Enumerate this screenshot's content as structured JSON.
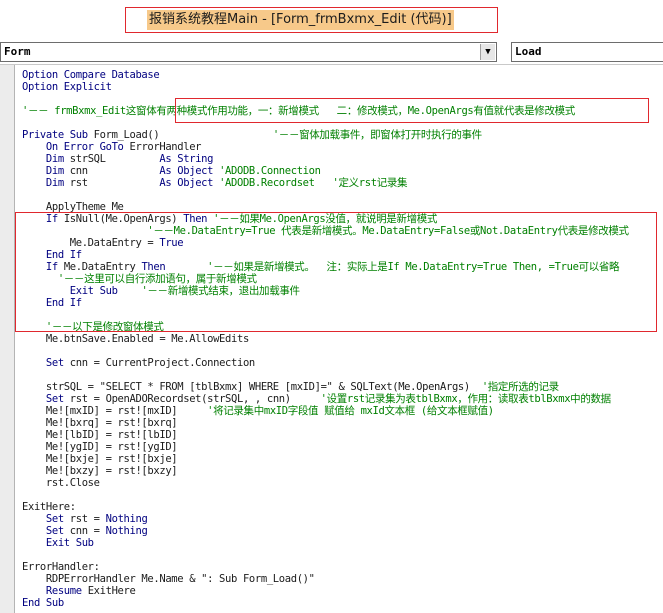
{
  "window": {
    "title": "报销系统教程Main - [Form_frmBxmx_Edit (代码)]"
  },
  "toolbar": {
    "object_combo": "Form",
    "procedure_combo": "Load"
  },
  "code_lines": [
    [
      {
        "t": "Option Compare Database",
        "c": "kw"
      }
    ],
    [
      {
        "t": "Option Explicit",
        "c": "kw"
      }
    ],
    [],
    [
      {
        "t": "'－－ frmBxmx_Edit这窗体有两种模式作用功能，一：新增模式   二：修改模式，Me.OpenArgs有值就代表是修改模式",
        "c": "cm"
      }
    ],
    [],
    [
      {
        "t": "Private Sub ",
        "c": "kw"
      },
      {
        "t": "Form_Load()",
        "c": "cn"
      },
      {
        "t": "                   '－－窗体加载事件，即窗体打开时执行的事件",
        "c": "cm"
      }
    ],
    [
      {
        "t": "    On Error GoTo ",
        "c": "kw"
      },
      {
        "t": "ErrorHandler",
        "c": "cn"
      }
    ],
    [
      {
        "t": "    Dim ",
        "c": "kw"
      },
      {
        "t": "strSQL         ",
        "c": "cn"
      },
      {
        "t": "As String",
        "c": "kw"
      }
    ],
    [
      {
        "t": "    Dim ",
        "c": "kw"
      },
      {
        "t": "cnn            ",
        "c": "cn"
      },
      {
        "t": "As Object ",
        "c": "kw"
      },
      {
        "t": "'ADODB.Connection",
        "c": "cm"
      }
    ],
    [
      {
        "t": "    Dim ",
        "c": "kw"
      },
      {
        "t": "rst            ",
        "c": "cn"
      },
      {
        "t": "As Object ",
        "c": "kw"
      },
      {
        "t": "'ADODB.Recordset   '定义rst记录集",
        "c": "cm"
      }
    ],
    [],
    [
      {
        "t": "    ApplyTheme Me",
        "c": "cn"
      }
    ],
    [
      {
        "t": "    If ",
        "c": "kw"
      },
      {
        "t": "IsNull(Me.OpenArgs) ",
        "c": "cn"
      },
      {
        "t": "Then ",
        "c": "kw"
      },
      {
        "t": "'－－如果Me.OpenArgs没值，就说明是新增模式",
        "c": "cm"
      }
    ],
    [
      {
        "t": "                     '－－Me.DataEntry=True 代表是新增模式。Me.DataEntry=False或Not.DataEntry代表是修改模式",
        "c": "cm"
      }
    ],
    [
      {
        "t": "        Me.DataEntry = ",
        "c": "cn"
      },
      {
        "t": "True",
        "c": "kw"
      }
    ],
    [
      {
        "t": "    End If",
        "c": "kw"
      }
    ],
    [
      {
        "t": "    If ",
        "c": "kw"
      },
      {
        "t": "Me.DataEntry ",
        "c": "cn"
      },
      {
        "t": "Then       ",
        "c": "kw"
      },
      {
        "t": "'－－如果是新增模式。  注：实际上是If Me.DataEntry=True Then, =True可以省略",
        "c": "cm"
      }
    ],
    [
      {
        "t": "      '－－这里可以自行添加语句，属于新增模式",
        "c": "cm"
      }
    ],
    [
      {
        "t": "        Exit Sub    ",
        "c": "kw"
      },
      {
        "t": "'－－新增模式结束，退出加载事件",
        "c": "cm"
      }
    ],
    [
      {
        "t": "    End If",
        "c": "kw"
      }
    ],
    [],
    [
      {
        "t": "    '－－以下是修改窗体模式",
        "c": "cm"
      }
    ],
    [
      {
        "t": "    Me.btnSave.Enabled = Me.AllowEdits",
        "c": "cn"
      }
    ],
    [],
    [
      {
        "t": "    Set ",
        "c": "kw"
      },
      {
        "t": "cnn = CurrentProject.Connection",
        "c": "cn"
      }
    ],
    [],
    [
      {
        "t": "    strSQL = \"SELECT * FROM [tblBxmx] WHERE [mxID]=\" & SQLText(Me.OpenArgs)  ",
        "c": "cn"
      },
      {
        "t": "'指定所选的记录",
        "c": "cm"
      }
    ],
    [
      {
        "t": "    Set ",
        "c": "kw"
      },
      {
        "t": "rst = OpenADORecordset(strSQL, , cnn)     ",
        "c": "cn"
      },
      {
        "t": "'设置rst记录集为表tblBxmx，作用：读取表tblBxmx中的数据",
        "c": "cm"
      }
    ],
    [
      {
        "t": "    Me![mxID] = rst![mxID]     ",
        "c": "cn"
      },
      {
        "t": "'将记录集中mxID字段值 赋值给 mxId文本框 (给文本框赋值)",
        "c": "cm"
      }
    ],
    [
      {
        "t": "    Me![bxrq] = rst![bxrq]",
        "c": "cn"
      }
    ],
    [
      {
        "t": "    Me![lbID] = rst![lbID]",
        "c": "cn"
      }
    ],
    [
      {
        "t": "    Me![ygID] = rst![ygID]",
        "c": "cn"
      }
    ],
    [
      {
        "t": "    Me![bxje] = rst![bxje]",
        "c": "cn"
      }
    ],
    [
      {
        "t": "    Me![bxzy] = rst![bxzy]",
        "c": "cn"
      }
    ],
    [
      {
        "t": "    rst.Close",
        "c": "cn"
      }
    ],
    [],
    [
      {
        "t": "ExitHere:",
        "c": "cn"
      }
    ],
    [
      {
        "t": "    Set ",
        "c": "kw"
      },
      {
        "t": "rst = ",
        "c": "cn"
      },
      {
        "t": "Nothing",
        "c": "kw"
      }
    ],
    [
      {
        "t": "    Set ",
        "c": "kw"
      },
      {
        "t": "cnn = ",
        "c": "cn"
      },
      {
        "t": "Nothing",
        "c": "kw"
      }
    ],
    [
      {
        "t": "    Exit Sub",
        "c": "kw"
      }
    ],
    [],
    [
      {
        "t": "ErrorHandler:",
        "c": "cn"
      }
    ],
    [
      {
        "t": "    RDPErrorHandler Me.Name & \": Sub Form_Load()\"",
        "c": "cn"
      }
    ],
    [
      {
        "t": "    Resume ",
        "c": "kw"
      },
      {
        "t": "ExitHere",
        "c": "cn"
      }
    ],
    [
      {
        "t": "End Sub",
        "c": "kw"
      }
    ]
  ]
}
